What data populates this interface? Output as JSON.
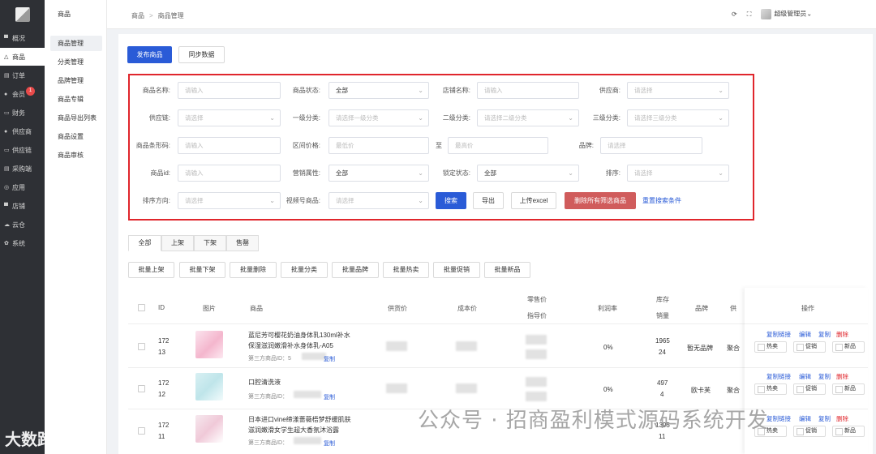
{
  "nav": {
    "items": [
      {
        "label": "概况",
        "icon": "dashboard-icon",
        "glyph": "▀"
      },
      {
        "label": "商品",
        "icon": "bag-icon",
        "glyph": "△"
      },
      {
        "label": "订单",
        "icon": "order-icon",
        "glyph": "▤"
      },
      {
        "label": "会员",
        "icon": "member-icon",
        "glyph": "●",
        "badge": "1"
      },
      {
        "label": "财务",
        "icon": "finance-icon",
        "glyph": "▭"
      },
      {
        "label": "供应商",
        "icon": "supplier-icon",
        "glyph": "●"
      },
      {
        "label": "供应链",
        "icon": "chain-icon",
        "glyph": "▭"
      },
      {
        "label": "采购端",
        "icon": "purchase-icon",
        "glyph": "▤"
      },
      {
        "label": "应用",
        "icon": "app-icon",
        "glyph": "◎"
      },
      {
        "label": "店铺",
        "icon": "store-icon",
        "glyph": "▀"
      },
      {
        "label": "云仓",
        "icon": "cloud-icon",
        "glyph": "☁"
      },
      {
        "label": "系统",
        "icon": "settings-icon",
        "glyph": "✿"
      }
    ]
  },
  "sub": {
    "title": "商品",
    "items": [
      "商品管理",
      "分类管理",
      "品牌管理",
      "商品专辑",
      "商品导出列表",
      "商品设置",
      "商品审核"
    ]
  },
  "top": {
    "crumb1": "商品",
    "crumb2": "商品管理",
    "user": "超级管理员"
  },
  "actions": {
    "publish": "发布商品",
    "sync": "同步数据"
  },
  "filter": {
    "name": "商品名称:",
    "status": "商品状态:",
    "store": "店铺名称:",
    "supplier": "供应商:",
    "chain": "供应链:",
    "cat1": "一级分类:",
    "cat2": "二级分类:",
    "cat3": "三级分类:",
    "barcode": "商品条形码:",
    "price": "区间价格:",
    "to": "至",
    "brand": "品牌:",
    "id": "商品id:",
    "marketing": "营销属性:",
    "lock": "锁定状态:",
    "sort": "排序:",
    "sortdir": "排序方向:",
    "video": "视频号商品:",
    "ph_input": "请输入",
    "ph_select": "请选择",
    "ph_cat1": "请选择一级分类",
    "ph_cat2": "请选择二级分类",
    "ph_cat3": "请选择三级分类",
    "ph_min": "最低价",
    "ph_max": "最高价",
    "all": "全部",
    "search": "搜索",
    "export": "导出",
    "upload": "上传excel",
    "delete_all": "删除所有筛选商品",
    "reset": "重置搜索条件"
  },
  "tabs": [
    "全部",
    "上架",
    "下架",
    "售罄"
  ],
  "batch": [
    "批量上架",
    "批量下架",
    "批量删除",
    "批量分类",
    "批量品牌",
    "批量热卖",
    "批量促销",
    "批量新品"
  ],
  "table": {
    "headers": {
      "id": "ID",
      "img": "图片",
      "product": "商品",
      "supply": "供货价",
      "cost": "成本价",
      "retail": "零售价",
      "guide": "指导价",
      "margin": "利润率",
      "stock": "库存",
      "sales": "销量",
      "brand": "品牌",
      "sup": "供",
      "op": "操作"
    },
    "rows": [
      {
        "id1": "172",
        "id2": "13",
        "title1": "蓝尼芳可樱花奶油身体乳130ml补水",
        "title2": "保湿滋润嫩滑补水身体乳-A05",
        "third": "第三方商品ID：5",
        "copy": "复制",
        "margin": "0%",
        "stock1": "1965",
        "stock2": "24",
        "brand": "暂无品牌",
        "sup": "聚合"
      },
      {
        "id1": "172",
        "id2": "12",
        "title1": "口腔清洗液",
        "title2": "",
        "third": "第三方商品ID：",
        "copy": "复制",
        "margin": "0%",
        "stock1": "497",
        "stock2": "4",
        "brand": "欧卡芙",
        "sup": "聚合"
      },
      {
        "id1": "172",
        "id2": "11",
        "title1": "日本进口vine缔漾蔷薇梧梦舒缓肌肤",
        "title2": "滋润嫩滑女学生超大香氛沐浴露",
        "third": "第三方商品ID：",
        "copy": "复制",
        "margin": "",
        "stock1": "1395",
        "stock2": "11",
        "brand": "",
        "sup": ""
      }
    ],
    "ops": {
      "copy_link": "复制链接",
      "edit": "编辑",
      "copy": "复制",
      "delete": "删除",
      "hot": "热卖",
      "promo": "促销",
      "new": "新品"
    }
  },
  "watermark": {
    "text": "公众号 · 招商盈利模式源码系统开发",
    "brand": "大数跨境"
  },
  "colors": {
    "primary": "#2a5bd7",
    "danger": "#e0262c",
    "nav_bg": "#2e3035"
  }
}
